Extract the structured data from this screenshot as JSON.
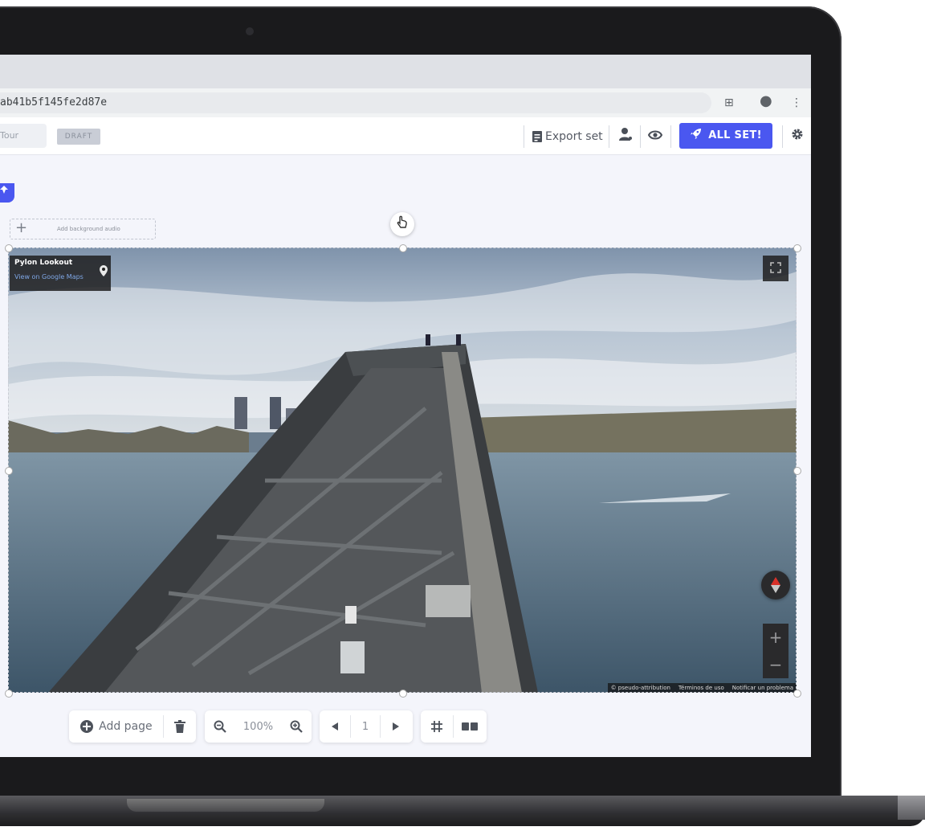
{
  "browser": {
    "url": "ab41b5f145fe2d87e",
    "extensions_icon": "⊞",
    "profile_icon": "●",
    "menu_icon": "⋮"
  },
  "toolbar": {
    "title_placeholder": "Tour",
    "status_badge": "DRAFT",
    "export_label": "Export set",
    "publish_label": "ALL SET!",
    "accent_color": "#4a57f0"
  },
  "canvas": {
    "add_audio_label": "Add background audio",
    "location": {
      "title": "Pylon Lookout",
      "link": "View on Google Maps"
    },
    "attribution": [
      "© pseudo-attribution",
      "Términos de uso",
      "Notificar un problema"
    ]
  },
  "bottom_toolbar": {
    "add_page_label": "Add page",
    "zoom_level": "100%",
    "page_number": "1"
  },
  "icons": {
    "export": "document-icon",
    "share": "user-icon",
    "preview": "eye-icon",
    "publish": "rocket-icon",
    "settings": "gear-icon",
    "add_page": "plus-circle-icon",
    "delete": "trash-icon",
    "zoom_out": "zoom-out-icon",
    "zoom_in": "zoom-in-icon",
    "prev": "prev-icon",
    "next": "next-icon",
    "grid": "grid-icon",
    "layout": "two-pane-icon"
  }
}
